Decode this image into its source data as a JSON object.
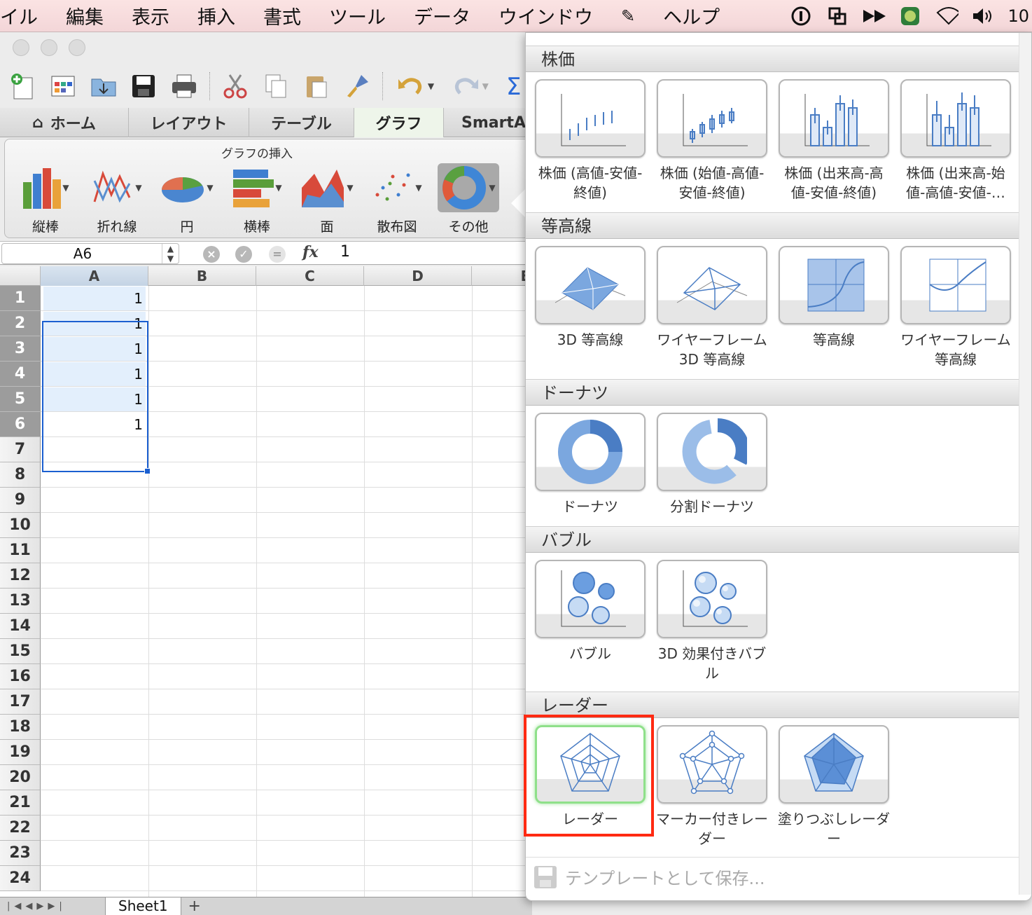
{
  "menubar": {
    "items": [
      "イル",
      "編集",
      "表示",
      "挿入",
      "書式",
      "ツール",
      "データ",
      "ウインドウ",
      "ヘルプ"
    ],
    "clock": "10"
  },
  "tabs": [
    "ホーム",
    "レイアウト",
    "テーブル",
    "グラフ",
    "SmartA"
  ],
  "ribbon": {
    "group_title": "グラフの挿入",
    "buttons": [
      "縦棒",
      "折れ線",
      "円",
      "横棒",
      "面",
      "散布図",
      "その他"
    ]
  },
  "formula": {
    "name_box": "A6",
    "fx_label": "fx",
    "value": "1"
  },
  "grid": {
    "columns": [
      "A",
      "B",
      "C",
      "D",
      "E"
    ],
    "rows": [
      "1",
      "2",
      "3",
      "4",
      "5",
      "6",
      "7",
      "8",
      "9",
      "10",
      "11",
      "12",
      "13",
      "14",
      "15",
      "16",
      "17",
      "18",
      "19",
      "20",
      "21",
      "22",
      "23",
      "24"
    ],
    "a_values": [
      "1",
      "1",
      "1",
      "1",
      "1",
      "1"
    ]
  },
  "sheet": {
    "tab": "Sheet1",
    "add": "+"
  },
  "gallery": {
    "sections": [
      {
        "title": "株価",
        "items": [
          "株価 (高値-安値-終値)",
          "株価 (始値-高値-安値-終値)",
          "株価 (出来高-高値-安値-終値)",
          "株価 (出来高-始値-高値-安値-…"
        ]
      },
      {
        "title": "等高線",
        "items": [
          "3D 等高線",
          "ワイヤーフレーム 3D 等高線",
          "等高線",
          "ワイヤーフレーム等高線"
        ]
      },
      {
        "title": "ドーナツ",
        "items": [
          "ドーナツ",
          "分割ドーナツ"
        ]
      },
      {
        "title": "バブル",
        "items": [
          "バブル",
          "3D 効果付きバブル"
        ]
      },
      {
        "title": "レーダー",
        "items": [
          "レーダー",
          "マーカー付きレーダー",
          "塗りつぶしレーダー"
        ]
      }
    ],
    "save_template": "テンプレートとして保存..."
  },
  "colors": {
    "selection": "#1b5fd0",
    "highlight": "#ff2a12",
    "chart_blue": "#6a9ad8"
  }
}
